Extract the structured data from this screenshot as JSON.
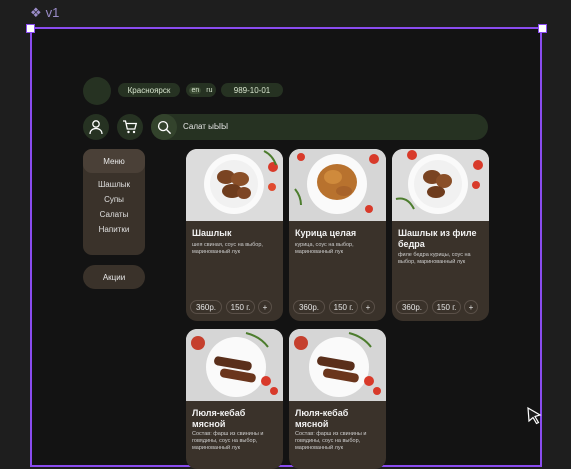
{
  "frame_label": "v1",
  "header": {
    "city": "Красноярск",
    "lang_en": "en",
    "lang_ru": "ru",
    "phone": "989-10-01",
    "search_value": "Салат ыЫЫ"
  },
  "menu": {
    "title": "Меню",
    "items": [
      "Шашлык",
      "Супы",
      "Салаты",
      "Напитки"
    ],
    "promo": "Акции"
  },
  "products": [
    {
      "title": "Шашлык",
      "desc": "шея свиная, соус на выбор, маринованный лук",
      "price": "360р.",
      "weight": "150 г.",
      "add": "+"
    },
    {
      "title": "Курица целая",
      "desc": "курица, соус на выбор, маринованный лук",
      "price": "360р.",
      "weight": "150 г.",
      "add": "+"
    },
    {
      "title": "Шашлык из филе бедра",
      "desc": "филе бедра курицы, соус на выбор, маринованный лук",
      "price": "360р.",
      "weight": "150 г.",
      "add": "+"
    },
    {
      "title": "Люля-кебаб мясной",
      "desc": "Состав: фарш из свинины и говядины, соус на выбор, маринованный лук"
    },
    {
      "title": "Люля-кебаб мясной",
      "desc": "Состав: фарш из свинины и говядины, соус на выбор, маринованный лук"
    }
  ]
}
